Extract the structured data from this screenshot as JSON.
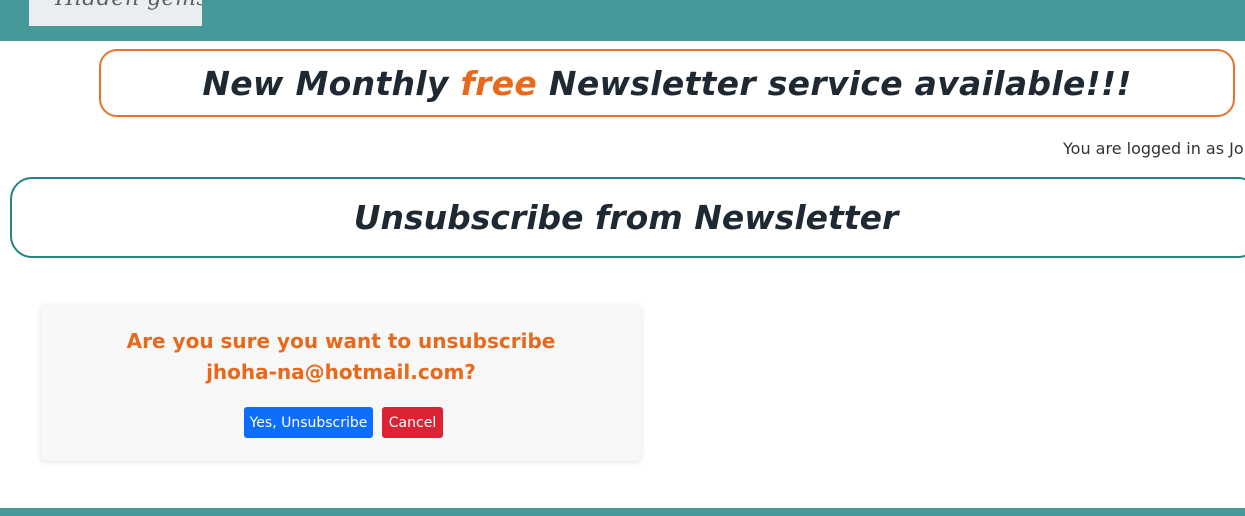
{
  "header": {
    "logo_text": "Hidden gems"
  },
  "banner": {
    "text_before": "New Monthly ",
    "highlight": "free",
    "text_after": " Newsletter service available!!!"
  },
  "user": {
    "status_text": "You are logged in as John"
  },
  "page": {
    "title": "Unsubscribe from Newsletter"
  },
  "confirm": {
    "question": "Are you sure you want to unsubscribe",
    "email_line": "jhoha-na@hotmail.com?",
    "confirm_label": "Yes, Unsubscribe",
    "cancel_label": "Cancel"
  },
  "colors": {
    "header_bg": "#459a99",
    "banner_border": "#e8732c",
    "highlight": "#e8691c",
    "heading_border": "#268384",
    "primary_button": "#0d6efd",
    "danger_button": "#dc2333"
  }
}
